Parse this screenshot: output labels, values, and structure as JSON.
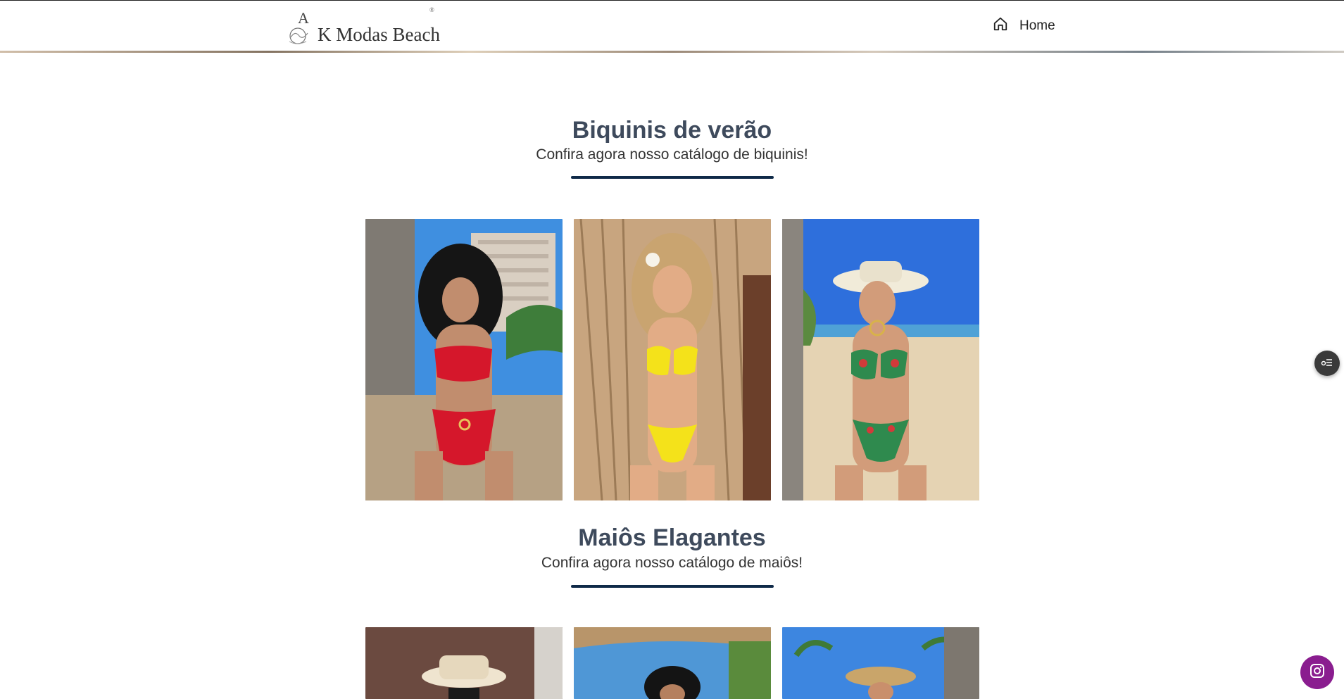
{
  "header": {
    "brand": {
      "mark": "A",
      "name": "K Modas Beach",
      "reg": "®"
    },
    "nav": {
      "home_label": "Home"
    }
  },
  "sections": [
    {
      "title": "Biquinis de verão",
      "subtitle": "Confira agora nosso catálogo de biquinis!",
      "photos": [
        {
          "name": "red-bikini-photo",
          "swimsuit_color": "#d5172b"
        },
        {
          "name": "yellow-bikini-photo",
          "swimsuit_color": "#f4e21a"
        },
        {
          "name": "floral-bikini-photo",
          "swimsuit_color": "#2f8a4e"
        }
      ]
    },
    {
      "title": "Maiôs Elagantes",
      "subtitle": "Confira agora nosso catálogo de maiôs!",
      "photos": [
        {
          "name": "one-piece-photo-1"
        },
        {
          "name": "one-piece-photo-2"
        },
        {
          "name": "one-piece-photo-3"
        }
      ]
    }
  ],
  "floating": {
    "side_button_icon": "list-toggle-icon",
    "instagram_icon": "instagram-icon",
    "instagram_color": "#8a1d8f"
  }
}
